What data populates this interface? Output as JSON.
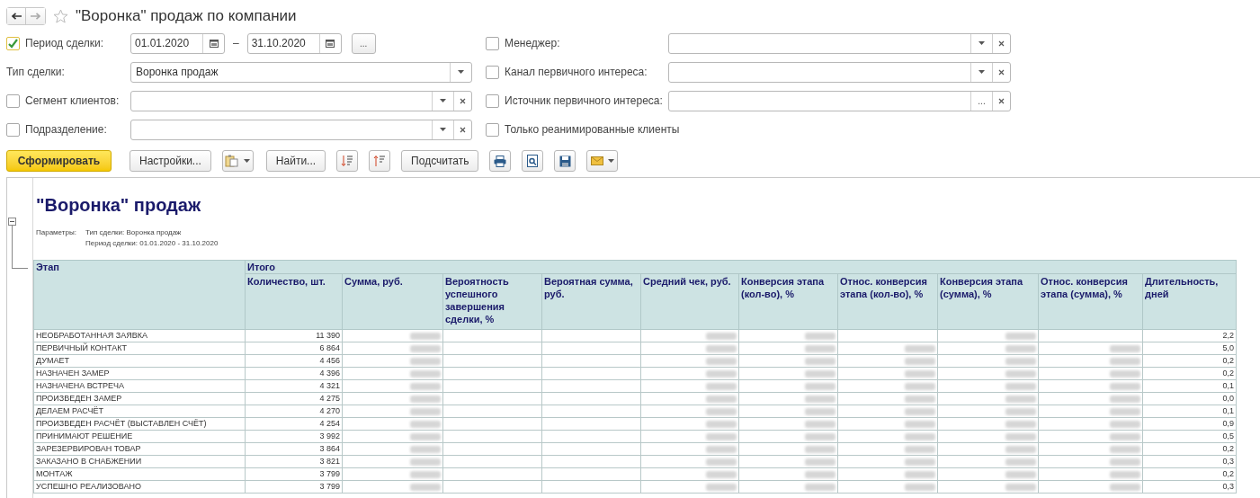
{
  "window": {
    "title": "\"Воронка\" продаж по компании"
  },
  "filters_left": [
    {
      "kind": "period",
      "label": "Период сделки:",
      "checked": true,
      "date_from": "01.01.2020",
      "separator": "–",
      "date_to": "31.10.2020",
      "more": "..."
    },
    {
      "kind": "select",
      "label": "Тип сделки:",
      "value": "Воронка продаж"
    },
    {
      "kind": "select_clear",
      "label": "Сегмент клиентов:",
      "checked": false
    },
    {
      "kind": "select_clear",
      "label": "Подразделение:",
      "checked": false
    }
  ],
  "filters_right": [
    {
      "kind": "select_clear",
      "label": "Менеджер:",
      "checked": false
    },
    {
      "kind": "select_clear",
      "label": "Канал первичного интереса:",
      "checked": false
    },
    {
      "kind": "choose_clear",
      "label": "Источник первичного интереса:",
      "checked": false,
      "more": "..."
    },
    {
      "kind": "check",
      "label": "Только реанимированные клиенты",
      "checked": false
    }
  ],
  "toolbar": [
    {
      "kind": "primary",
      "label": "Сформировать"
    },
    {
      "kind": "text",
      "label": "Настройки..."
    },
    {
      "kind": "icon_menu"
    },
    {
      "kind": "text",
      "label": "Найти..."
    },
    {
      "kind": "icon"
    },
    {
      "kind": "icon"
    },
    {
      "kind": "text",
      "label": "Подсчитать"
    },
    {
      "kind": "icon"
    },
    {
      "kind": "icon"
    },
    {
      "kind": "icon"
    },
    {
      "kind": "icon_menu"
    }
  ],
  "report": {
    "title": "\"Воронка\" продаж",
    "params_label": "Параметры:",
    "params": [
      "Тип сделки: Воронка продаж",
      "Период сделки: 01.01.2020 - 31.10.2020"
    ],
    "table": {
      "stage_header": "Этап",
      "group_header": "Итого",
      "columns": [
        "Количество, шт.",
        "Сумма, руб.",
        "Вероятность успешного завершения сделки, %",
        "Вероятная сумма, руб.",
        "Средний чек, руб.",
        "Конверсия этапа (кол-во), %",
        "Относ. конверсия этапа (кол-во), %",
        "Конверсия этапа (сумма), %",
        "Относ. конверсия этапа (сумма), %",
        "Длительность, дней"
      ],
      "rows": [
        {
          "stage": "НЕОБРАБОТАННАЯ ЗАЯВКА",
          "cells": [
            {
              "kind": "text",
              "text": "11 390"
            },
            {
              "kind": "blurred"
            },
            {
              "kind": "empty"
            },
            {
              "kind": "empty"
            },
            {
              "kind": "blurred"
            },
            {
              "kind": "blurred"
            },
            {
              "kind": "empty"
            },
            {
              "kind": "blurred"
            },
            {
              "kind": "empty"
            },
            {
              "kind": "text",
              "text": "2,2"
            }
          ]
        },
        {
          "stage": "ПЕРВИЧНЫЙ КОНТАКТ",
          "cells": [
            {
              "kind": "text",
              "text": "6 864"
            },
            {
              "kind": "blurred"
            },
            {
              "kind": "empty"
            },
            {
              "kind": "empty"
            },
            {
              "kind": "blurred"
            },
            {
              "kind": "blurred"
            },
            {
              "kind": "blurred"
            },
            {
              "kind": "blurred"
            },
            {
              "kind": "blurred"
            },
            {
              "kind": "text",
              "text": "5,0"
            }
          ]
        },
        {
          "stage": "ДУМАЕТ",
          "cells": [
            {
              "kind": "text",
              "text": "4 456"
            },
            {
              "kind": "blurred"
            },
            {
              "kind": "empty"
            },
            {
              "kind": "empty"
            },
            {
              "kind": "blurred"
            },
            {
              "kind": "blurred"
            },
            {
              "kind": "blurred"
            },
            {
              "kind": "blurred"
            },
            {
              "kind": "blurred"
            },
            {
              "kind": "text",
              "text": "0,2"
            }
          ]
        },
        {
          "stage": "НАЗНАЧЕН ЗАМЕР",
          "cells": [
            {
              "kind": "text",
              "text": "4 396"
            },
            {
              "kind": "blurred"
            },
            {
              "kind": "empty"
            },
            {
              "kind": "empty"
            },
            {
              "kind": "blurred"
            },
            {
              "kind": "blurred"
            },
            {
              "kind": "blurred"
            },
            {
              "kind": "blurred"
            },
            {
              "kind": "blurred"
            },
            {
              "kind": "text",
              "text": "0,2"
            }
          ]
        },
        {
          "stage": "НАЗНАЧЕНА ВСТРЕЧА",
          "cells": [
            {
              "kind": "text",
              "text": "4 321"
            },
            {
              "kind": "blurred"
            },
            {
              "kind": "empty"
            },
            {
              "kind": "empty"
            },
            {
              "kind": "blurred"
            },
            {
              "kind": "blurred"
            },
            {
              "kind": "blurred"
            },
            {
              "kind": "blurred"
            },
            {
              "kind": "blurred"
            },
            {
              "kind": "text",
              "text": "0,1"
            }
          ]
        },
        {
          "stage": "ПРОИЗВЕДЕН ЗАМЕР",
          "cells": [
            {
              "kind": "text",
              "text": "4 275"
            },
            {
              "kind": "blurred"
            },
            {
              "kind": "empty"
            },
            {
              "kind": "empty"
            },
            {
              "kind": "blurred"
            },
            {
              "kind": "blurred"
            },
            {
              "kind": "blurred"
            },
            {
              "kind": "blurred"
            },
            {
              "kind": "blurred"
            },
            {
              "kind": "text",
              "text": "0,0"
            }
          ]
        },
        {
          "stage": "ДЕЛАЕМ РАСЧЁТ",
          "cells": [
            {
              "kind": "text",
              "text": "4 270"
            },
            {
              "kind": "blurred"
            },
            {
              "kind": "empty"
            },
            {
              "kind": "empty"
            },
            {
              "kind": "blurred"
            },
            {
              "kind": "blurred"
            },
            {
              "kind": "blurred"
            },
            {
              "kind": "blurred"
            },
            {
              "kind": "blurred"
            },
            {
              "kind": "text",
              "text": "0,1"
            }
          ]
        },
        {
          "stage": "ПРОИЗВЕДЕН РАСЧЁТ (ВЫСТАВЛЕН СЧЁТ)",
          "cells": [
            {
              "kind": "text",
              "text": "4 254"
            },
            {
              "kind": "blurred"
            },
            {
              "kind": "empty"
            },
            {
              "kind": "empty"
            },
            {
              "kind": "blurred"
            },
            {
              "kind": "blurred"
            },
            {
              "kind": "blurred"
            },
            {
              "kind": "blurred"
            },
            {
              "kind": "blurred"
            },
            {
              "kind": "text",
              "text": "0,9"
            }
          ]
        },
        {
          "stage": "ПРИНИМАЮТ РЕШЕНИЕ",
          "cells": [
            {
              "kind": "text",
              "text": "3 992"
            },
            {
              "kind": "blurred"
            },
            {
              "kind": "empty"
            },
            {
              "kind": "empty"
            },
            {
              "kind": "blurred"
            },
            {
              "kind": "blurred"
            },
            {
              "kind": "blurred"
            },
            {
              "kind": "blurred"
            },
            {
              "kind": "blurred"
            },
            {
              "kind": "text",
              "text": "0,5"
            }
          ]
        },
        {
          "stage": "ЗАРЕЗЕРВИРОВАН ТОВАР",
          "cells": [
            {
              "kind": "text",
              "text": "3 864"
            },
            {
              "kind": "blurred"
            },
            {
              "kind": "empty"
            },
            {
              "kind": "empty"
            },
            {
              "kind": "blurred"
            },
            {
              "kind": "blurred"
            },
            {
              "kind": "blurred"
            },
            {
              "kind": "blurred"
            },
            {
              "kind": "blurred"
            },
            {
              "kind": "text",
              "text": "0,2"
            }
          ]
        },
        {
          "stage": "ЗАКАЗАНО В СНАБЖЕНИИ",
          "cells": [
            {
              "kind": "text",
              "text": "3 821"
            },
            {
              "kind": "blurred"
            },
            {
              "kind": "empty"
            },
            {
              "kind": "empty"
            },
            {
              "kind": "blurred"
            },
            {
              "kind": "blurred"
            },
            {
              "kind": "blurred"
            },
            {
              "kind": "blurred"
            },
            {
              "kind": "blurred"
            },
            {
              "kind": "text",
              "text": "0,3"
            }
          ]
        },
        {
          "stage": "МОНТАЖ",
          "cells": [
            {
              "kind": "text",
              "text": "3 799"
            },
            {
              "kind": "blurred"
            },
            {
              "kind": "empty"
            },
            {
              "kind": "empty"
            },
            {
              "kind": "blurred"
            },
            {
              "kind": "blurred"
            },
            {
              "kind": "blurred"
            },
            {
              "kind": "blurred"
            },
            {
              "kind": "blurred"
            },
            {
              "kind": "text",
              "text": "0,2"
            }
          ]
        },
        {
          "stage": "УСПЕШНО РЕАЛИЗОВАНО",
          "cells": [
            {
              "kind": "text",
              "text": "3 799"
            },
            {
              "kind": "blurred"
            },
            {
              "kind": "empty"
            },
            {
              "kind": "empty"
            },
            {
              "kind": "blurred"
            },
            {
              "kind": "blurred"
            },
            {
              "kind": "blurred"
            },
            {
              "kind": "blurred"
            },
            {
              "kind": "blurred"
            },
            {
              "kind": "text",
              "text": "0,3"
            }
          ]
        }
      ]
    }
  }
}
